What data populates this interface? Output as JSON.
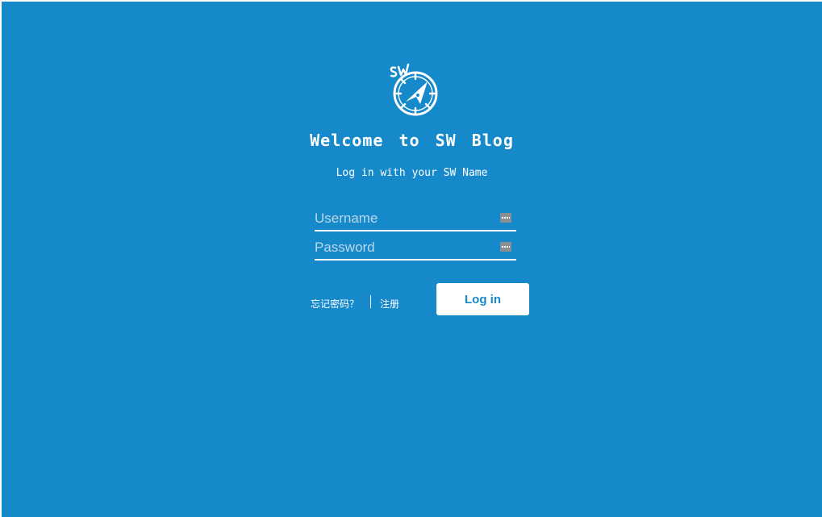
{
  "header": {
    "logo_icon": "compass-icon",
    "title": "Welcome to SW Blog",
    "subtitle": "Log in with your SW Name"
  },
  "form": {
    "username": {
      "value": "",
      "placeholder": "Username",
      "icon": "password-manager-icon"
    },
    "password": {
      "value": "",
      "placeholder": "Password",
      "icon": "password-manager-icon"
    },
    "forgot_label": "忘记密码？",
    "register_label": "注册",
    "login_label": "Log in"
  },
  "colors": {
    "background": "#1589c9",
    "foreground": "#ffffff",
    "button_text": "#1589c9"
  }
}
